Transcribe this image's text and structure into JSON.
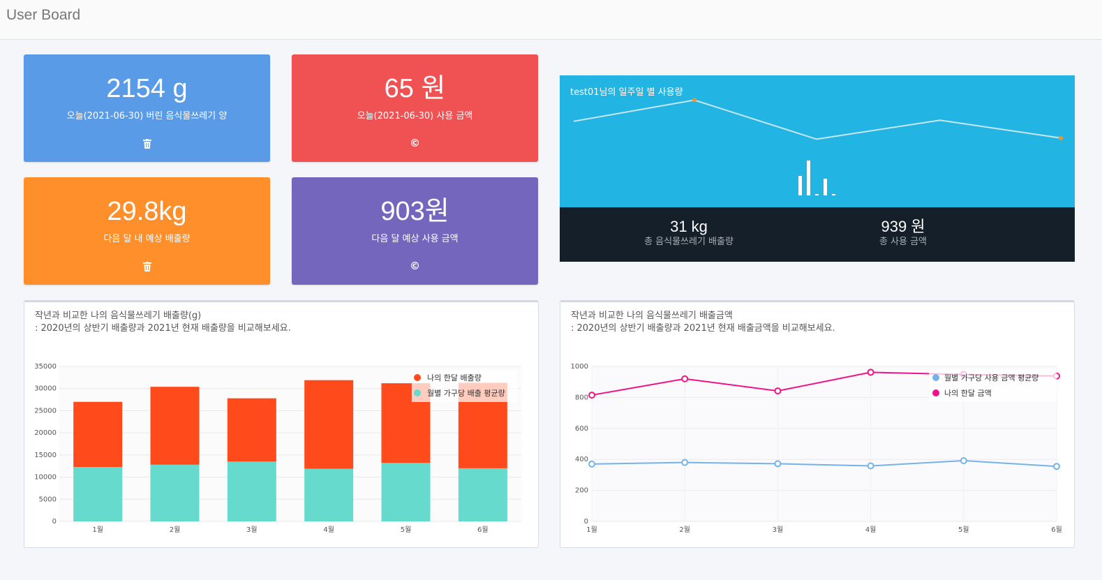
{
  "header": {
    "title": "User Board"
  },
  "cards": {
    "today_amount": {
      "value": "2154 g",
      "label": "오늘(2021-06-30) 버린 음식물쓰레기 양",
      "icon": "trash-icon"
    },
    "today_cost": {
      "value": "65 원",
      "label": "오늘(2021-06-30) 사용 금액",
      "icon": "copyright-icon"
    },
    "next_amount": {
      "value": "29.8kg",
      "label": "다음 달 내 예상 배출량",
      "icon": "trash-icon"
    },
    "next_cost": {
      "value": "903원",
      "label": "다음 달 예상 사용 금액",
      "icon": "copyright-icon"
    }
  },
  "weekly": {
    "title": "test01님의 일주일 별 사용량",
    "total_amount": {
      "value": "31 kg",
      "label": "총 음식물쓰레기 배출량"
    },
    "total_cost": {
      "value": "939 원",
      "label": "총 사용 금액"
    },
    "line_values": [
      62,
      81,
      46,
      63,
      47
    ],
    "bar_values": [
      28,
      50,
      2,
      24,
      2
    ]
  },
  "colors": {
    "blue": "#5a9be8",
    "red": "#f05152",
    "orange": "#ff8f2b",
    "purple": "#7566bd",
    "cyan": "#22b5e4",
    "dark": "#151f29",
    "bar_mine": "#ff4a1c",
    "bar_avg": "#66dacd",
    "line_pink": "#f0128a",
    "line_blue": "#74b3ea"
  },
  "chart_left": {
    "title_line1": "작년과 비교한 나의 음식물쓰레기 배출량(g)",
    "title_line2": ": 2020년의 상반기 배출량과 2021년 현재 배출량을 비교해보세요."
  },
  "chart_right": {
    "title_line1": "작년과 비교한 나의 음식물쓰레기 배출금액",
    "title_line2": ": 2020년의 상반기 배출량과 2021년 현재 배출금액을 비교해보세요."
  },
  "chart_data": [
    {
      "type": "bar",
      "stacked": true,
      "categories": [
        "1월",
        "2월",
        "3월",
        "4월",
        "5월",
        "6월"
      ],
      "series": [
        {
          "name": "나의 한달 배출량",
          "values": [
            14700,
            17600,
            14300,
            20000,
            18000,
            19300
          ]
        },
        {
          "name": "월별 가구당 배출 평균량",
          "values": [
            12300,
            12800,
            13500,
            11900,
            13200,
            12000
          ]
        }
      ],
      "ylim": [
        0,
        35000
      ],
      "yticks": [
        0,
        5000,
        10000,
        15000,
        20000,
        25000,
        30000,
        35000
      ],
      "legend": "top-right",
      "grid": true
    },
    {
      "type": "line",
      "categories": [
        "1월",
        "2월",
        "3월",
        "4월",
        "5월",
        "6월"
      ],
      "series": [
        {
          "name": "월별 가구당 사용 금액 평균량",
          "values": [
            370,
            380,
            372,
            358,
            392,
            355
          ]
        },
        {
          "name": "나의 한달 금액",
          "values": [
            815,
            920,
            842,
            962,
            948,
            938
          ]
        }
      ],
      "ylim": [
        0,
        1000
      ],
      "yticks": [
        0,
        200,
        400,
        600,
        800,
        1000
      ],
      "legend": "top-right",
      "grid": true
    }
  ]
}
